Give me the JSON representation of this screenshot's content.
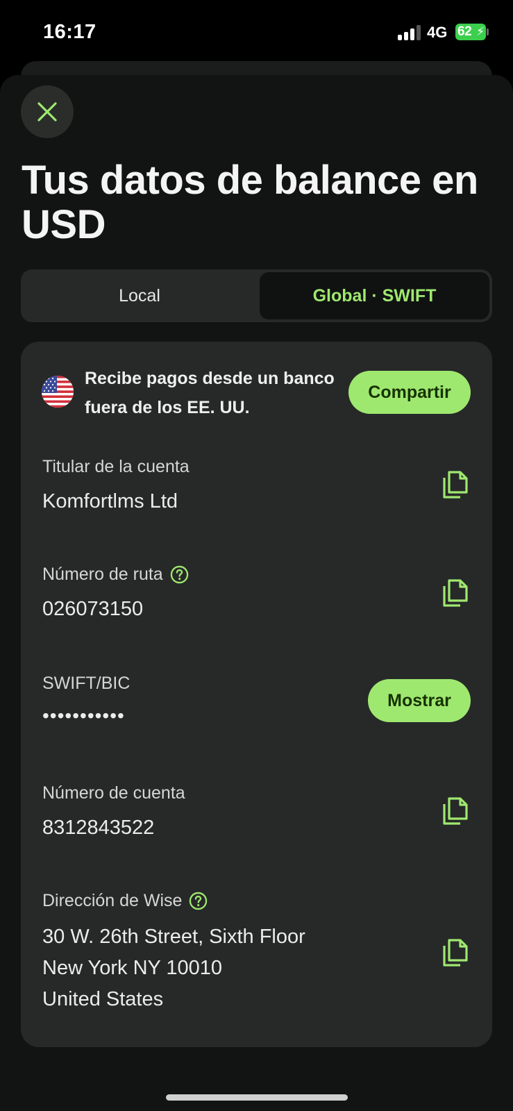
{
  "status_bar": {
    "time": "16:17",
    "network": "4G",
    "battery": "62"
  },
  "header": {
    "close_icon": "close-icon",
    "title": "Tus datos de balance en USD"
  },
  "tabs": [
    {
      "label": "Local",
      "selected": false
    },
    {
      "label": "Global · SWIFT",
      "selected": true
    }
  ],
  "receive": {
    "flag_icon": "us-flag-icon",
    "text": "Recibe pagos desde un banco fuera de los EE. UU.",
    "share_label": "Compartir"
  },
  "fields": {
    "holder": {
      "label": "Titular de la cuenta",
      "value": "Komfortlms Ltd"
    },
    "routing": {
      "label": "Número de ruta",
      "value": "026073150"
    },
    "swift": {
      "label": "SWIFT/BIC",
      "value": "•••••••••••",
      "show_label": "Mostrar"
    },
    "account": {
      "label": "Número de cuenta",
      "value": "8312843522"
    },
    "address": {
      "label": "Dirección de Wise",
      "lines": [
        "30 W. 26th Street, Sixth Floor",
        "New York NY 10010",
        "United States"
      ]
    }
  },
  "colors": {
    "accent": "#9fe870",
    "background": "#121413",
    "card": "#272928",
    "accent_text": "#163300"
  }
}
